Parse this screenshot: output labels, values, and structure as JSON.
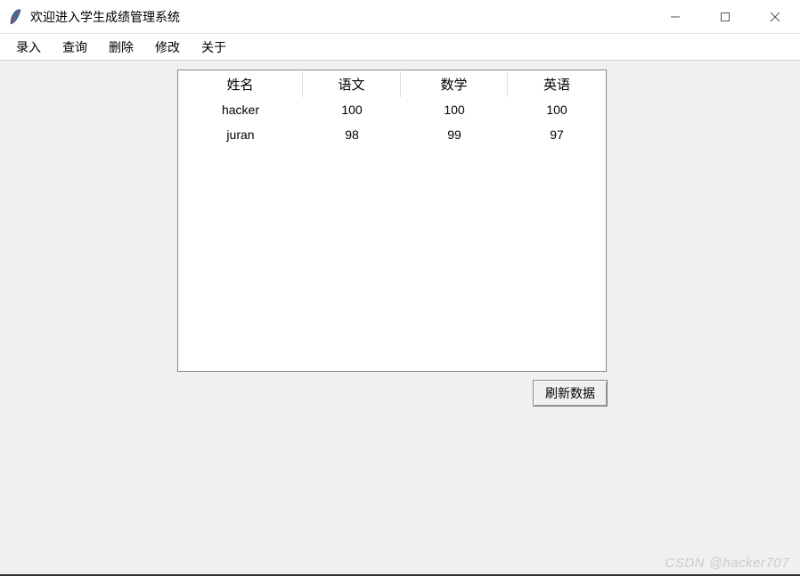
{
  "window": {
    "title": "欢迎进入学生成绩管理系统"
  },
  "menubar": {
    "items": [
      {
        "label": "录入"
      },
      {
        "label": "查询"
      },
      {
        "label": "删除"
      },
      {
        "label": "修改"
      },
      {
        "label": "关于"
      }
    ]
  },
  "table": {
    "headers": {
      "name": "姓名",
      "chinese": "语文",
      "math": "数学",
      "english": "英语"
    },
    "rows": [
      {
        "name": "hacker",
        "chinese": "100",
        "math": "100",
        "english": "100"
      },
      {
        "name": "juran",
        "chinese": "98",
        "math": "99",
        "english": "97"
      }
    ]
  },
  "buttons": {
    "refresh": "刷新数据"
  },
  "watermark": "CSDN @hacker707"
}
